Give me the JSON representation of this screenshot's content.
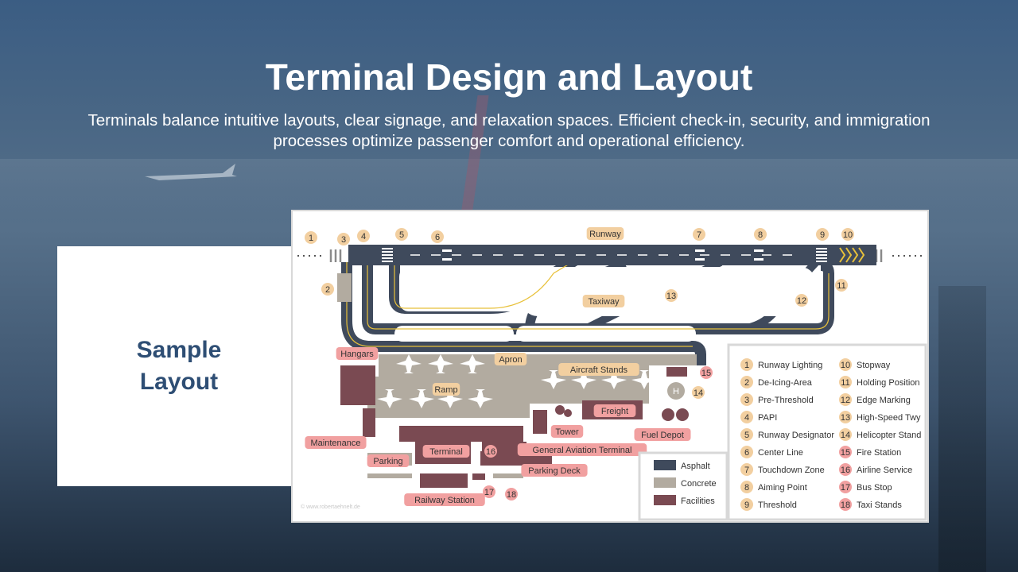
{
  "slide": {
    "title": "Terminal Design and Layout",
    "subtitle": "Terminals balance intuitive layouts, clear signage, and relaxation spaces. Efficient check-in, security, and immigration processes optimize passenger comfort and operational efficiency.",
    "side_label": "Sample Layout"
  },
  "diagram": {
    "labels": {
      "runway": "Runway",
      "taxiway": "Taxiway",
      "hangars": "Hangars",
      "apron": "Apron",
      "aircraft_stands": "Aircraft Stands",
      "ramp": "Ramp",
      "maintenance": "Maintenance",
      "freight": "Freight",
      "tower": "Tower",
      "fuel_depot": "Fuel Depot",
      "terminal": "Terminal",
      "general_aviation_terminal": "General Aviation Terminal",
      "parking": "Parking",
      "parking_deck": "Parking Deck",
      "railway_station": "Railway Station",
      "helipad_letter": "H",
      "credit": "© www.robertaehnelt.de"
    },
    "markers": [
      "1",
      "2",
      "3",
      "4",
      "5",
      "6",
      "7",
      "8",
      "9",
      "10",
      "11",
      "12",
      "13",
      "14",
      "15",
      "16",
      "17",
      "18"
    ],
    "legend": [
      {
        "num": "1",
        "text": "Runway Lighting"
      },
      {
        "num": "2",
        "text": "De-Icing-Area"
      },
      {
        "num": "3",
        "text": "Pre-Threshold"
      },
      {
        "num": "4",
        "text": "PAPI"
      },
      {
        "num": "5",
        "text": "Runway Designator"
      },
      {
        "num": "6",
        "text": "Center Line"
      },
      {
        "num": "7",
        "text": "Touchdown Zone"
      },
      {
        "num": "8",
        "text": "Aiming Point"
      },
      {
        "num": "9",
        "text": "Threshold"
      },
      {
        "num": "10",
        "text": "Stopway"
      },
      {
        "num": "11",
        "text": "Holding Position"
      },
      {
        "num": "12",
        "text": "Edge Marking"
      },
      {
        "num": "13",
        "text": "High-Speed Twy"
      },
      {
        "num": "14",
        "text": "Helicopter Stand"
      },
      {
        "num": "15",
        "text": "Fire Station"
      },
      {
        "num": "16",
        "text": "Airline Service"
      },
      {
        "num": "17",
        "text": "Bus Stop"
      },
      {
        "num": "18",
        "text": "Taxi Stands"
      }
    ],
    "surface_key": [
      {
        "text": "Asphalt",
        "color": "#3f4a5c"
      },
      {
        "text": "Concrete",
        "color": "#b2aba0"
      },
      {
        "text": "Facilities",
        "color": "#7a4a52"
      }
    ],
    "colors": {
      "asphalt": "#3f4a5c",
      "concrete": "#b2aba0",
      "facility": "#7a4a52",
      "marker_light": "#f2cfa0",
      "marker_red": "#f1a0a0",
      "taxi_line": "#e8c13a"
    }
  }
}
